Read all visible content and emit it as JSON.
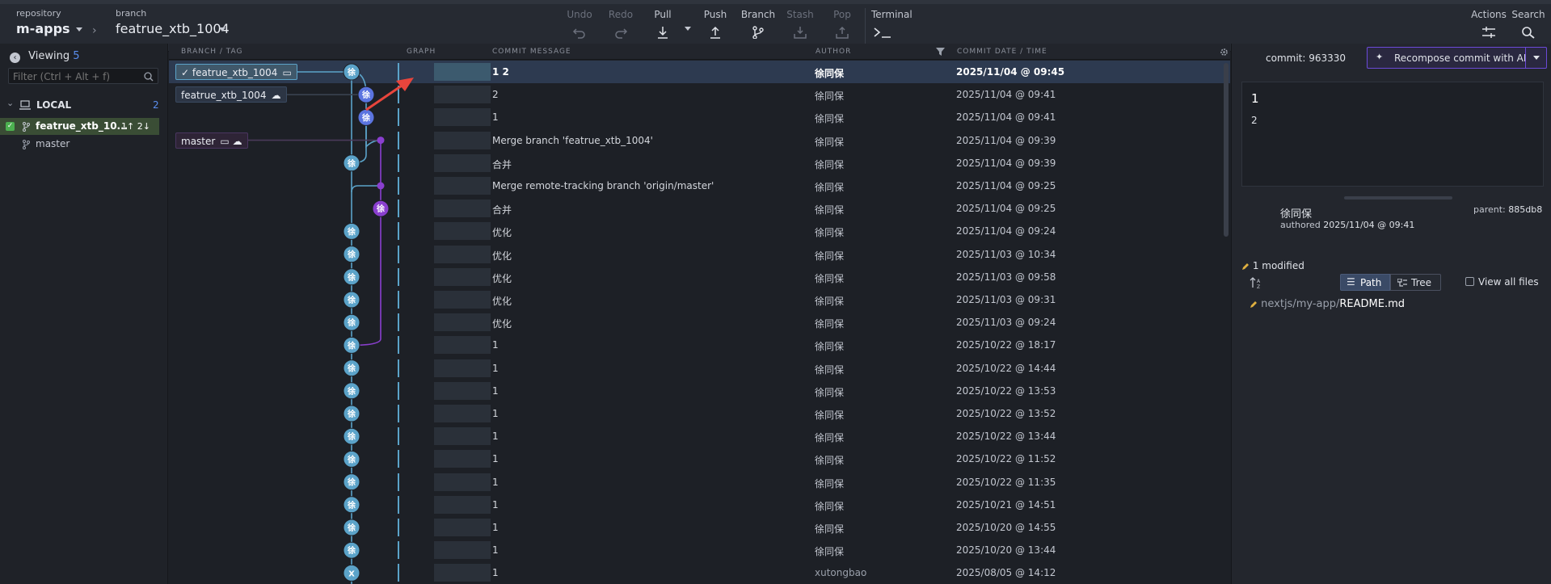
{
  "toolbar": {
    "repository_label": "repository",
    "repository_name": "m-apps",
    "branch_label": "branch",
    "branch_name": "featrue_xtb_1004",
    "undo": "Undo",
    "redo": "Redo",
    "pull": "Pull",
    "push": "Push",
    "branch": "Branch",
    "stash": "Stash",
    "pop": "Pop",
    "terminal": "Terminal",
    "actions": "Actions",
    "search": "Search"
  },
  "sidebar": {
    "viewing_label": "Viewing",
    "viewing_count": "5",
    "filter_placeholder": "Filter (Ctrl + Alt + f)",
    "local_label": "LOCAL",
    "local_count": "2",
    "branches": [
      {
        "name": "featrue_xtb_10...",
        "ahead_behind": "1↑ 2↓",
        "checked": true
      },
      {
        "name": "master",
        "ahead_behind": "",
        "checked": false
      }
    ]
  },
  "columns": {
    "branch_tag": "BRANCH / TAG",
    "graph": "GRAPH",
    "commit_message": "COMMIT MESSAGE",
    "author": "AUTHOR",
    "commit_date": "COMMIT DATE / TIME"
  },
  "branch_labels": [
    {
      "text": "featrue_xtb_1004",
      "row": 0,
      "current": true
    },
    {
      "text": "featrue_xtb_1004",
      "row": 1,
      "current": false
    },
    {
      "text": "master",
      "row": 3,
      "current": false
    }
  ],
  "commits": [
    {
      "message": "1  2",
      "author": "徐同保",
      "date": "2025/11/04 @ 09:45",
      "lane": 0,
      "avatar": "徐"
    },
    {
      "message": "2",
      "author": "徐同保",
      "date": "2025/11/04 @ 09:41",
      "lane": 1,
      "avatar": "徐"
    },
    {
      "message": "1",
      "author": "徐同保",
      "date": "2025/11/04 @ 09:41",
      "lane": 1,
      "avatar": "徐"
    },
    {
      "message": "Merge branch 'featrue_xtb_1004'",
      "author": "徐同保",
      "date": "2025/11/04 @ 09:39",
      "lane": 2,
      "avatar": ""
    },
    {
      "message": "合并",
      "author": "徐同保",
      "date": "2025/11/04 @ 09:39",
      "lane": 0,
      "avatar": "徐"
    },
    {
      "message": "Merge remote-tracking branch 'origin/master'",
      "author": "徐同保",
      "date": "2025/11/04 @ 09:25",
      "lane": 2,
      "avatar": ""
    },
    {
      "message": "合并",
      "author": "徐同保",
      "date": "2025/11/04 @ 09:25",
      "lane": 2,
      "avatar": "徐"
    },
    {
      "message": "优化",
      "author": "徐同保",
      "date": "2025/11/04 @ 09:24",
      "lane": 0,
      "avatar": "徐"
    },
    {
      "message": "优化",
      "author": "徐同保",
      "date": "2025/11/03 @ 10:34",
      "lane": 0,
      "avatar": "徐"
    },
    {
      "message": "优化",
      "author": "徐同保",
      "date": "2025/11/03 @ 09:58",
      "lane": 0,
      "avatar": "徐"
    },
    {
      "message": "优化",
      "author": "徐同保",
      "date": "2025/11/03 @ 09:31",
      "lane": 0,
      "avatar": "徐"
    },
    {
      "message": "优化",
      "author": "徐同保",
      "date": "2025/11/03 @ 09:24",
      "lane": 0,
      "avatar": "徐"
    },
    {
      "message": "1",
      "author": "徐同保",
      "date": "2025/10/22 @ 18:17",
      "lane": 0,
      "avatar": "徐"
    },
    {
      "message": "1",
      "author": "徐同保",
      "date": "2025/10/22 @ 14:44",
      "lane": 0,
      "avatar": "徐"
    },
    {
      "message": "1",
      "author": "徐同保",
      "date": "2025/10/22 @ 13:53",
      "lane": 0,
      "avatar": "徐"
    },
    {
      "message": "1",
      "author": "徐同保",
      "date": "2025/10/22 @ 13:52",
      "lane": 0,
      "avatar": "徐"
    },
    {
      "message": "1",
      "author": "徐同保",
      "date": "2025/10/22 @ 13:44",
      "lane": 0,
      "avatar": "徐"
    },
    {
      "message": "1",
      "author": "徐同保",
      "date": "2025/10/22 @ 11:52",
      "lane": 0,
      "avatar": "徐"
    },
    {
      "message": "1",
      "author": "徐同保",
      "date": "2025/10/22 @ 11:35",
      "lane": 0,
      "avatar": "徐"
    },
    {
      "message": "1",
      "author": "徐同保",
      "date": "2025/10/21 @ 14:51",
      "lane": 0,
      "avatar": "徐"
    },
    {
      "message": "1",
      "author": "徐同保",
      "date": "2025/10/20 @ 14:55",
      "lane": 0,
      "avatar": "徐"
    },
    {
      "message": "1",
      "author": "徐同保",
      "date": "2025/10/20 @ 13:44",
      "lane": 0,
      "avatar": "徐"
    },
    {
      "message": "1",
      "author": "xutongbao",
      "date": "2025/08/05 @ 14:12",
      "lane": 0,
      "avatar": "X"
    }
  ],
  "details": {
    "commit_label": "commit:",
    "commit_sha": "963330",
    "recompose_label": "Recompose commit with AI",
    "message_summary": "1",
    "message_body": "2",
    "author_name": "徐同保",
    "authored_label": "authored",
    "authored_date": "2025/11/04 @ 09:41",
    "parent_label": "parent:",
    "parent_sha": "885db8",
    "modified_label": "1 modified",
    "path_label": "Path",
    "tree_label": "Tree",
    "view_all_label": "View all files",
    "file_dir": "nextjs/my-app/",
    "file_name": "README.md"
  },
  "colors": {
    "lane0": "#5ba3c9",
    "lane1": "#5b74e0",
    "lane2": "#8a3fcf",
    "accent": "#6b4ad8",
    "annotation": "#e8453c"
  }
}
